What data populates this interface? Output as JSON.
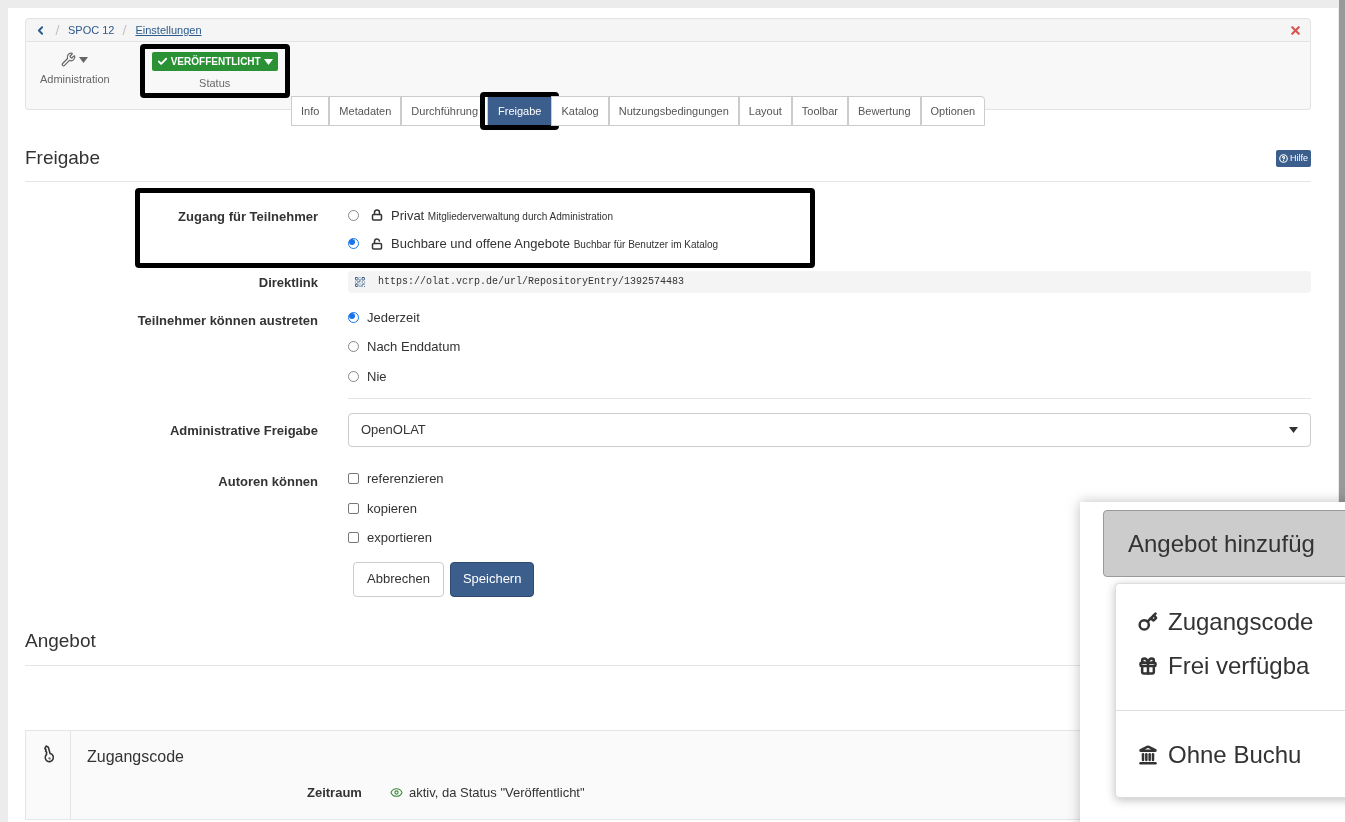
{
  "breadcrumb": {
    "items": [
      "SPOC 12",
      "Einstellungen"
    ]
  },
  "toolbar": {
    "admin_label": "Administration",
    "status": {
      "value": "VERÖFFENTLICHT",
      "label": "Status",
      "highlighted": true
    }
  },
  "tabs": [
    {
      "label": "Info",
      "selected": false,
      "highlighted": false
    },
    {
      "label": "Metadaten",
      "selected": false,
      "highlighted": false
    },
    {
      "label": "Durchführung",
      "selected": false,
      "highlighted": false
    },
    {
      "label": "Freigabe",
      "selected": true,
      "highlighted": true
    },
    {
      "label": "Katalog",
      "selected": false,
      "highlighted": false
    },
    {
      "label": "Nutzungsbedingungen",
      "selected": false,
      "highlighted": false
    },
    {
      "label": "Layout",
      "selected": false,
      "highlighted": false
    },
    {
      "label": "Toolbar",
      "selected": false,
      "highlighted": false
    },
    {
      "label": "Bewertung",
      "selected": false,
      "highlighted": false
    },
    {
      "label": "Optionen",
      "selected": false,
      "highlighted": false
    }
  ],
  "section_title": "Freigabe",
  "help_button": "Hilfe",
  "access": {
    "label": "Zugang für Teilnehmer",
    "highlighted": true,
    "options": [
      {
        "kind": "locked",
        "title": "Privat",
        "note": "Mitgliederverwaltung durch Administration",
        "selected": false
      },
      {
        "kind": "unlocked",
        "title": "Buchbare und offene Angebote",
        "note": "Buchbar für Benutzer im Katalog",
        "selected": true
      }
    ]
  },
  "direct_link": {
    "label": "Direktlink",
    "url": "https://olat.vcrp.de/url/RepositoryEntry/1392574483"
  },
  "leave": {
    "label": "Teilnehmer können austreten",
    "options": [
      {
        "label": "Jederzeit",
        "selected": true
      },
      {
        "label": "Nach Enddatum",
        "selected": false
      },
      {
        "label": "Nie",
        "selected": false
      }
    ]
  },
  "admin_release": {
    "label": "Administrative Freigabe",
    "value": "OpenOLAT"
  },
  "authors": {
    "label": "Autoren können",
    "options": [
      {
        "label": "referenzieren",
        "checked": false
      },
      {
        "label": "kopieren",
        "checked": false
      },
      {
        "label": "exportieren",
        "checked": false
      }
    ]
  },
  "buttons": {
    "cancel": "Abbrechen",
    "save": "Speichern"
  },
  "offer_title": "Angebot",
  "offer_card": {
    "title": "Zugangscode",
    "period_label": "Zeitraum",
    "period_value": "aktiv, da Status \"Veröffentlicht\""
  },
  "callout": {
    "button": "Angebot hinzufüg",
    "menu": [
      {
        "kind": "key",
        "label": "Zugangscode"
      },
      {
        "kind": "gift",
        "label": "Frei verfügba"
      },
      {
        "kind": "divider"
      },
      {
        "kind": "building",
        "label": "Ohne Buchu"
      }
    ]
  }
}
